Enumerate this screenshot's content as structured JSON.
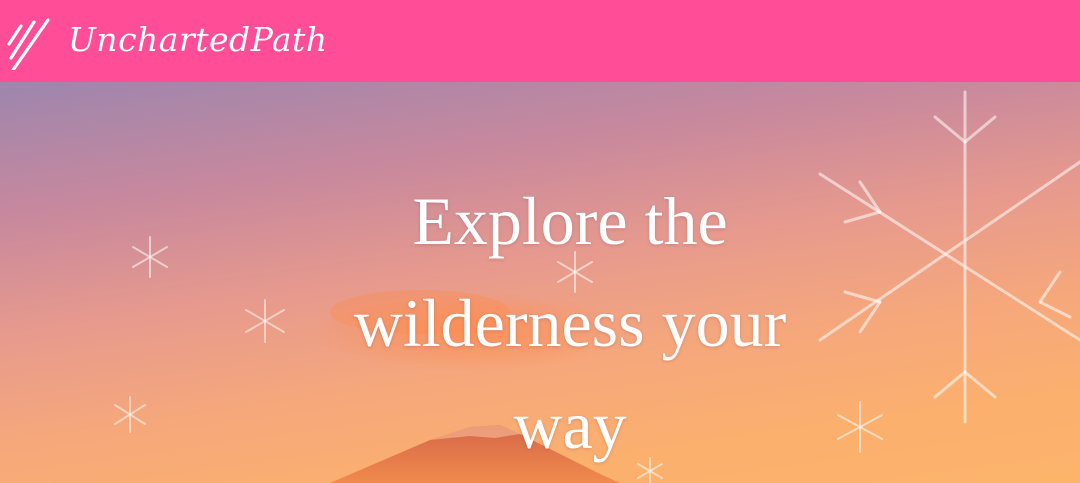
{
  "header": {
    "brand_name": "UnchartedPath",
    "logo_icon": "triple-slash-logo-icon",
    "background_color": "#ff4d98"
  },
  "hero": {
    "headline": "Explore the wilderness your way",
    "background_image": "sunset-mountain-snowflakes",
    "text_color": "#ffffff"
  }
}
